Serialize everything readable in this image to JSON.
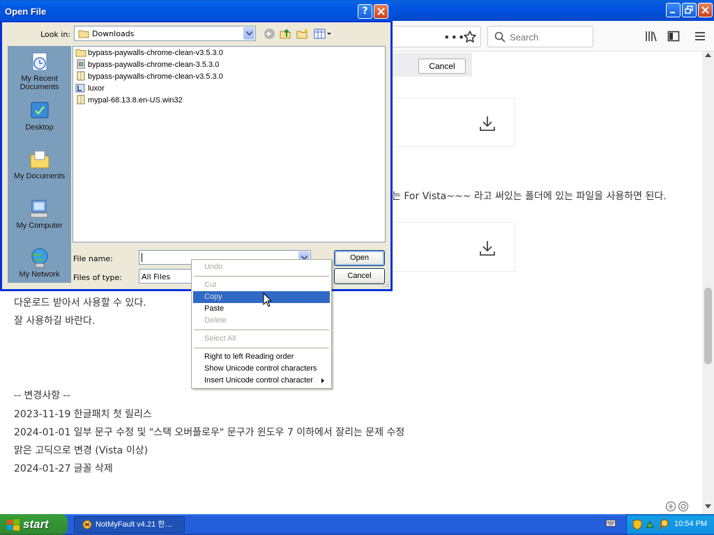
{
  "browser": {
    "search_placeholder": "Search",
    "notification_cancel": "Cancel",
    "page_text": {
      "line_vista": "는 For Vista~~~ 라고 써있는 폴더에 있는 파일을 사용하면 된다.",
      "line_download": "다운로드 받아서 사용할 수 있다.",
      "line_enjoy": "잘 사용하길 바란다.",
      "changelog_header": "-- 변경사항 --",
      "changelog": [
        "2023-11-19 한글패치 첫 릴리스",
        "2024-01-01 일부 문구 수정 및 \"스택 오버플로우\" 문구가 윈도우 7 이하에서 잘리는 문제 수정",
        "맑은 고딕으로 변경 (Vista 이상)",
        "2024-01-27 글꼴 삭제"
      ]
    }
  },
  "dialog": {
    "title": "Open File",
    "help_label": "?",
    "look_in_label": "Look in:",
    "look_in_value": "Downloads",
    "places": [
      {
        "label": "My Recent Documents",
        "icon": "recent-documents-icon"
      },
      {
        "label": "Desktop",
        "icon": "desktop-icon"
      },
      {
        "label": "My Documents",
        "icon": "my-documents-icon"
      },
      {
        "label": "My Computer",
        "icon": "my-computer-icon"
      },
      {
        "label": "My Network",
        "icon": "my-network-icon"
      }
    ],
    "files": [
      {
        "name": "bypass-paywalls-chrome-clean-v3.5.3.0",
        "icon": "folder-icon"
      },
      {
        "name": "bypass-paywalls-chrome-clean-3.5.3.0",
        "icon": "archive-icon"
      },
      {
        "name": "bypass-paywalls-chrome-clean-v3.5.3.0",
        "icon": "zip-icon"
      },
      {
        "name": "luxor",
        "icon": "luxor-icon"
      },
      {
        "name": "mypal-68.13.8.en-US.win32",
        "icon": "zip-icon"
      }
    ],
    "file_name_label": "File name:",
    "file_name_value": "",
    "files_of_type_label": "Files of type:",
    "files_of_type_value": "All Files",
    "open_button": "Open",
    "cancel_button": "Cancel"
  },
  "context_menu": {
    "items": [
      {
        "label": "Undo",
        "enabled": false
      },
      {
        "label": "Cut",
        "enabled": false
      },
      {
        "label": "Copy",
        "enabled": false,
        "highlighted": true
      },
      {
        "label": "Paste",
        "enabled": true
      },
      {
        "label": "Delete",
        "enabled": false
      },
      {
        "label": "Select All",
        "enabled": false
      },
      {
        "label": "Right to left Reading order",
        "enabled": true
      },
      {
        "label": "Show Unicode control characters",
        "enabled": true
      },
      {
        "label": "Insert Unicode control character",
        "enabled": true,
        "submenu": true
      }
    ]
  },
  "taskbar": {
    "start_label": "start",
    "task_item": "NotMyFault v4.21 한…",
    "clock": "10:54 PM"
  },
  "colors": {
    "xp_title_blue": "#0054e3",
    "menu_highlight": "#316ac5",
    "dialog_face": "#ece9d8",
    "start_green": "#379c37"
  }
}
